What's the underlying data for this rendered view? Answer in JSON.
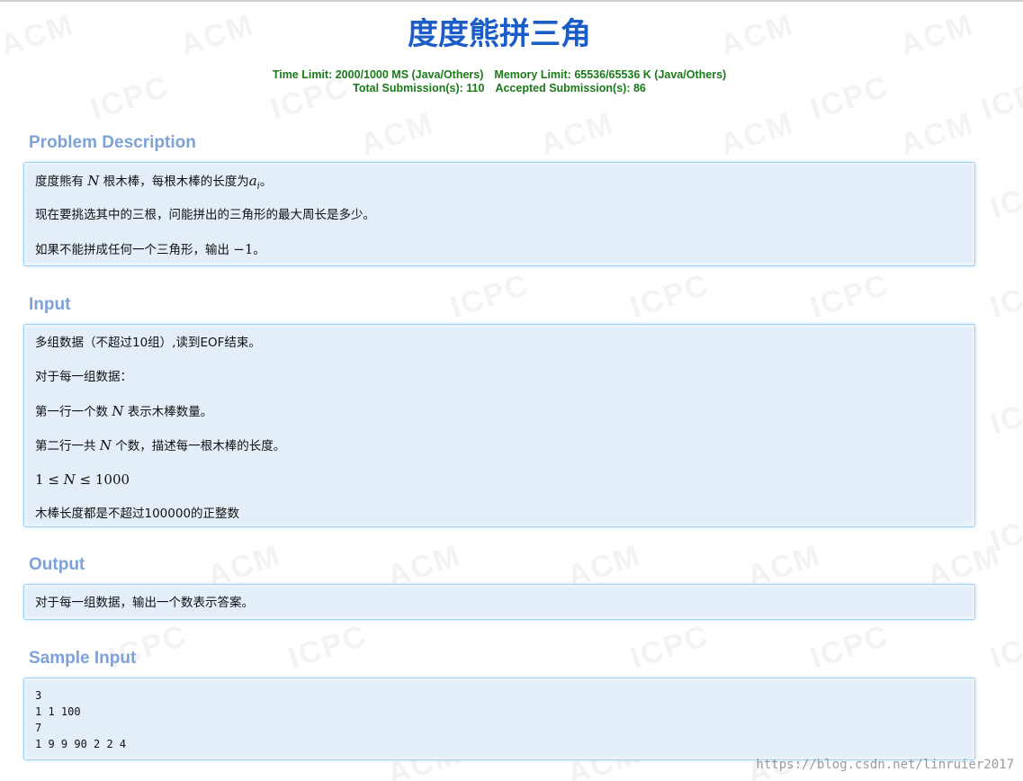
{
  "title": "度度熊拼三角",
  "limits": {
    "time": "Time Limit: 2000/1000 MS (Java/Others)",
    "memory": "Memory Limit: 65536/65536 K (Java/Others)",
    "total": "Total Submission(s): 110",
    "accepted": "Accepted Submission(s): 86"
  },
  "sections": {
    "description": {
      "title": "Problem Description",
      "l1_a": "度度熊有 ",
      "l1_var": "N",
      "l1_b": " 根木棒，每根木棒的长度为",
      "l1_ai": "a",
      "l1_sub": "i",
      "l1_c": "。",
      "l2": "现在要挑选其中的三根，问能拼出的三角形的最大周长是多少。",
      "l3_a": "如果不能拼成任何一个三角形，输出 ",
      "l3_val": "−1",
      "l3_b": "。"
    },
    "input": {
      "title": "Input",
      "l1": "多组数据（不超过10组）,读到EOF结束。",
      "l2": "对于每一组数据：",
      "l3_a": "第一行一个数 ",
      "l3_var": "N",
      "l3_b": " 表示木棒数量。",
      "l4_a": "第二行一共 ",
      "l4_var": "N",
      "l4_b": " 个数，描述每一根木棒的长度。",
      "l5_1": "1",
      "l5_le1": " ≤ ",
      "l5_var": "N",
      "l5_le2": " ≤ ",
      "l5_2": "1000",
      "l6": "木棒长度都是不超过100000的正整数"
    },
    "output": {
      "title": "Output",
      "l1": "对于每一组数据，输出一个数表示答案。"
    },
    "sample_input": {
      "title": "Sample Input",
      "line1": "3",
      "line2": "1 1 100",
      "line3": "7",
      "line4": "1 9 9 90 2 2 4"
    }
  },
  "footer_url": "https://blog.csdn.net/linruier2017"
}
